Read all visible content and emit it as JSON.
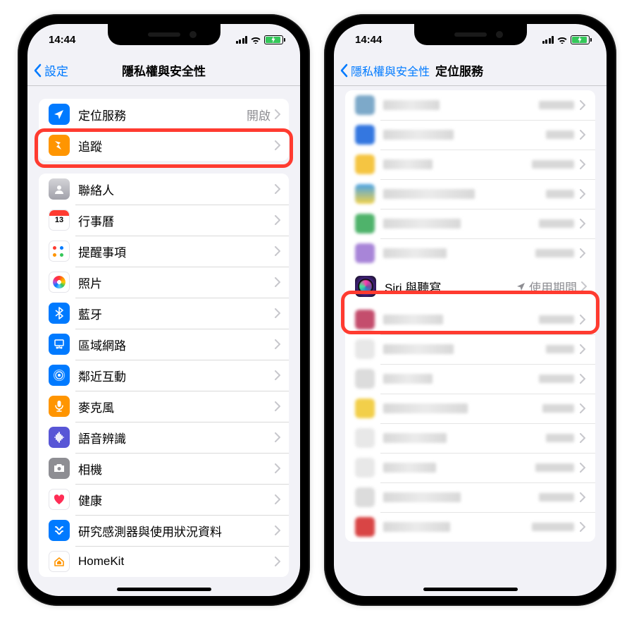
{
  "status": {
    "time": "14:44"
  },
  "phone1": {
    "back_label": "設定",
    "title": "隱私權與安全性",
    "group1": [
      {
        "label": "定位服務",
        "value": "開啟",
        "icon": "location",
        "color": "#007aff"
      },
      {
        "label": "追蹤",
        "icon": "tracking",
        "color": "#ff9500"
      }
    ],
    "group2": [
      {
        "label": "聯絡人",
        "icon": "contacts"
      },
      {
        "label": "行事曆",
        "icon": "calendar"
      },
      {
        "label": "提醒事項",
        "icon": "reminders"
      },
      {
        "label": "照片",
        "icon": "photos"
      },
      {
        "label": "藍牙",
        "icon": "bluetooth",
        "color": "#007aff"
      },
      {
        "label": "區域網路",
        "icon": "lan",
        "color": "#007aff"
      },
      {
        "label": "鄰近互動",
        "icon": "nearby",
        "color": "#007aff"
      },
      {
        "label": "麥克風",
        "icon": "microphone",
        "color": "#ff9500"
      },
      {
        "label": "語音辨識",
        "icon": "speech",
        "color": "#5856d6"
      },
      {
        "label": "相機",
        "icon": "camera",
        "color": "#8e8e93"
      },
      {
        "label": "健康",
        "icon": "health",
        "color": "#ffffff"
      },
      {
        "label": "研究感測器與使用狀況資料",
        "icon": "research",
        "color": "#007aff"
      },
      {
        "label": "HomeKit",
        "icon": "homekit",
        "color": "#ffffff"
      }
    ]
  },
  "phone2": {
    "back_label": "隱私權與安全性",
    "title": "定位服務",
    "siri": {
      "label": "Siri 與聽寫",
      "value": "使用期間"
    }
  }
}
